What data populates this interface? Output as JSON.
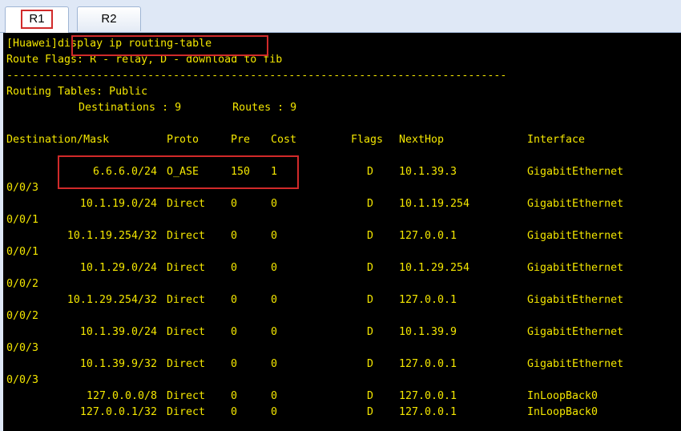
{
  "tabs": [
    {
      "label": "R1",
      "active": true
    },
    {
      "label": "R2",
      "active": false
    }
  ],
  "terminal": {
    "prompt": "[Huawei]",
    "command": "display ip routing-table",
    "flags_line": "Route Flags: R - relay, D - download to fib",
    "separator": "------------------------------------------------------------------------------",
    "tables_line": "Routing Tables: Public",
    "destinations_line": "Destinations : 9        Routes : 9",
    "headers": [
      "Destination/Mask",
      "Proto",
      "Pre",
      "Cost",
      "Flags",
      "NextHop",
      "Interface"
    ],
    "routes": [
      {
        "dest": "6.6.6.0/24",
        "proto": "O_ASE",
        "pre": "150",
        "cost": "1",
        "flags": "D",
        "nexthop": "10.1.39.3",
        "iface": "GigabitEthernet",
        "iface_cont": "0/0/3"
      },
      {
        "dest": "10.1.19.0/24",
        "proto": "Direct",
        "pre": "0",
        "cost": "0",
        "flags": "D",
        "nexthop": "10.1.19.254",
        "iface": "GigabitEthernet",
        "iface_cont": "0/0/1"
      },
      {
        "dest": "10.1.19.254/32",
        "proto": "Direct",
        "pre": "0",
        "cost": "0",
        "flags": "D",
        "nexthop": "127.0.0.1",
        "iface": "GigabitEthernet",
        "iface_cont": "0/0/1"
      },
      {
        "dest": "10.1.29.0/24",
        "proto": "Direct",
        "pre": "0",
        "cost": "0",
        "flags": "D",
        "nexthop": "10.1.29.254",
        "iface": "GigabitEthernet",
        "iface_cont": "0/0/2"
      },
      {
        "dest": "10.1.29.254/32",
        "proto": "Direct",
        "pre": "0",
        "cost": "0",
        "flags": "D",
        "nexthop": "127.0.0.1",
        "iface": "GigabitEthernet",
        "iface_cont": "0/0/2"
      },
      {
        "dest": "10.1.39.0/24",
        "proto": "Direct",
        "pre": "0",
        "cost": "0",
        "flags": "D",
        "nexthop": "10.1.39.9",
        "iface": "GigabitEthernet",
        "iface_cont": "0/0/3"
      },
      {
        "dest": "10.1.39.9/32",
        "proto": "Direct",
        "pre": "0",
        "cost": "0",
        "flags": "D",
        "nexthop": "127.0.0.1",
        "iface": "GigabitEthernet",
        "iface_cont": "0/0/3"
      },
      {
        "dest": "127.0.0.0/8",
        "proto": "Direct",
        "pre": "0",
        "cost": "0",
        "flags": "D",
        "nexthop": "127.0.0.1",
        "iface": "InLoopBack0",
        "iface_cont": ""
      },
      {
        "dest": "127.0.0.1/32",
        "proto": "Direct",
        "pre": "0",
        "cost": "0",
        "flags": "D",
        "nexthop": "127.0.0.1",
        "iface": "InLoopBack0",
        "iface_cont": ""
      }
    ]
  },
  "colors": {
    "text": "#f3e600",
    "background": "#000000",
    "highlight": "#d12a2a"
  }
}
